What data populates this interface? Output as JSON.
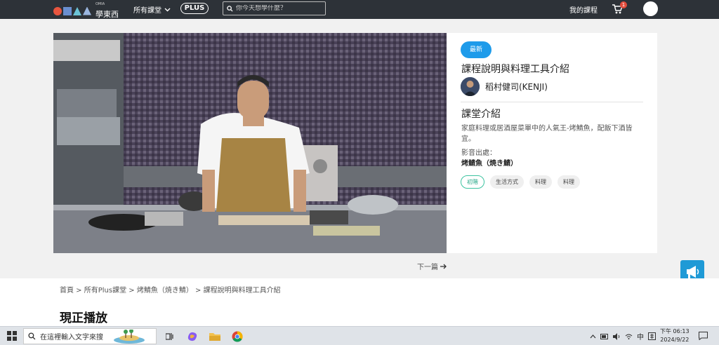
{
  "header": {
    "logo_small": "OMIA",
    "logo_text": "學東西",
    "nav_courses": "所有課堂",
    "plus": "PLUS",
    "search_placeholder": "你今天想學什麼？",
    "my_courses": "我的課程",
    "cart_count": "1"
  },
  "course": {
    "badge": "最新",
    "title": "課程說明與料理工具介紹",
    "teacher": "稻村健司(KENJI)",
    "intro_heading": "課堂介紹",
    "intro_text": "家庭料理或居酒屋菜單中的人氣王-烤鯖魚，配飯下酒皆宜。",
    "source_label": "影音出處：",
    "source_value": "烤鯖魚（焼き鯖）",
    "tags": [
      "初階",
      "生活方式",
      "料理",
      "料理"
    ]
  },
  "next_label": "下一篇",
  "breadcrumb": "首頁 > 所有Plus課堂 > 烤鯖魚（焼き鯖） > 課程說明與料理工具介紹",
  "now_playing": "現正播放",
  "taskbar": {
    "search_placeholder": "在這裡輸入文字來搜",
    "ime": "中",
    "time": "下午 06:13",
    "date": "2024/9/22"
  },
  "colors": {
    "topbar": "#2d3238",
    "accent": "#1e9bea",
    "tag_level": "#3cc3a0",
    "float_button": "#1f9ad6"
  }
}
